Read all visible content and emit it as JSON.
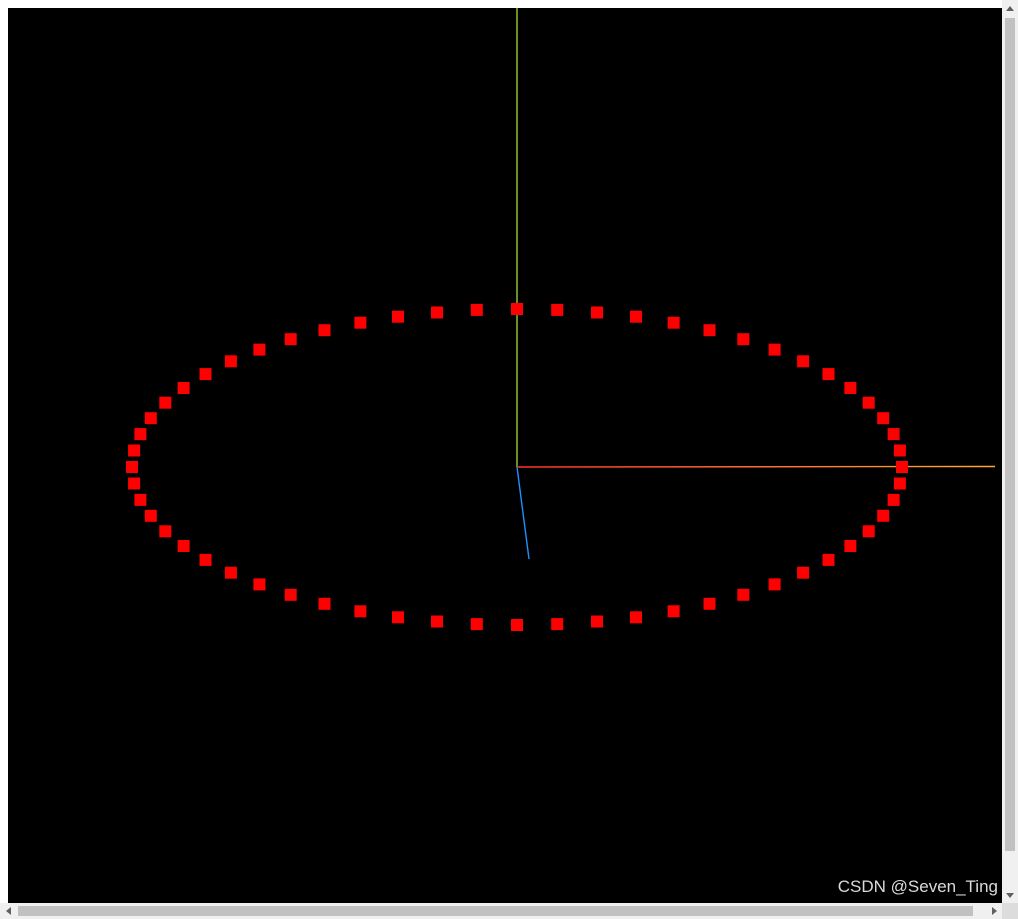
{
  "scene": {
    "background": "#000000",
    "axes": {
      "x_color_start": "#ff3030",
      "x_color_end": "#ffaa30",
      "y_color": "#9acd32",
      "z_color": "#1e90ff"
    },
    "points": {
      "count": 60,
      "color": "#ff0000",
      "shape": "square"
    }
  },
  "watermark": {
    "text": "CSDN @Seven_Ting"
  },
  "scrollbars": {
    "vertical_up_icon": "arrow-up-icon",
    "vertical_down_icon": "arrow-down-icon",
    "horizontal_left_icon": "arrow-left-icon",
    "horizontal_right_icon": "arrow-right-icon"
  }
}
